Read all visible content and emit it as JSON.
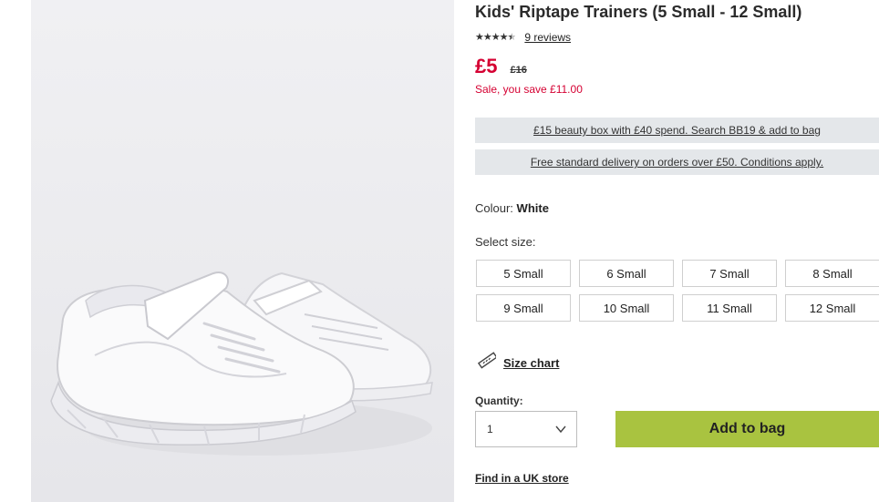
{
  "product": {
    "title": "Kids' Riptape Trainers (5 Small - 12 Small)",
    "image_alt": "White kids trainers",
    "rating": 4.5,
    "rating_max": 5,
    "reviews_label": "9 reviews",
    "price": "£5",
    "was_price": "£16",
    "saving": "Sale, you save £11.00"
  },
  "promos": [
    "£15 beauty box with £40 spend. Search BB19 & add to bag",
    "Free standard delivery on orders over £50. Conditions apply."
  ],
  "colour": {
    "label": "Colour:",
    "value": "White"
  },
  "size": {
    "label": "Select size:",
    "options": [
      "5 Small",
      "6 Small",
      "7 Small",
      "8 Small",
      "9 Small",
      "10 Small",
      "11 Small",
      "12 Small"
    ]
  },
  "size_chart_label": "Size chart",
  "quantity": {
    "label": "Quantity:",
    "value": "1"
  },
  "add_to_bag_label": "Add to bag",
  "find_store_label": "Find in a UK store",
  "icons": {
    "size_chart": "ruler-icon",
    "quantity": "chevron-down-icon"
  },
  "colors": {
    "price": "#d50032",
    "add_to_bag": "#a9c340",
    "promo_bg": "#e4e7ea"
  }
}
